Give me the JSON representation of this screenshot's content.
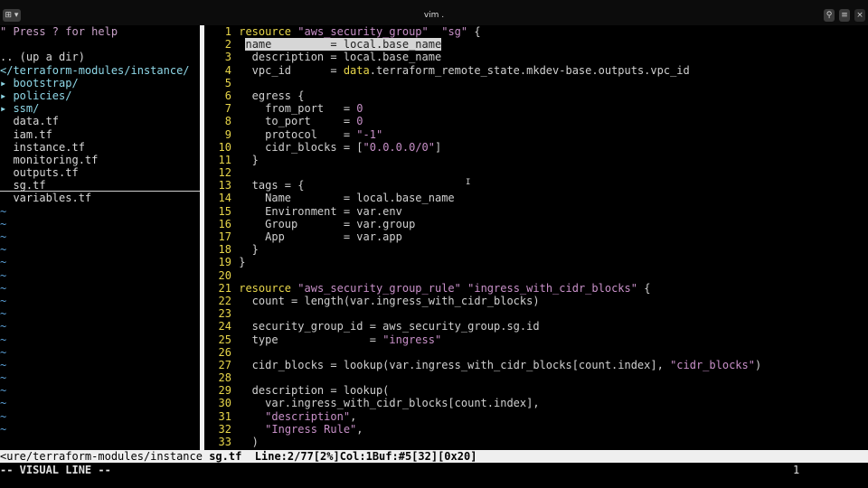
{
  "window": {
    "title": "vim .",
    "left_icon": "⊞ ▾",
    "search_icon": "🔍",
    "menu_icon": "≡",
    "close_icon": "×"
  },
  "tree": {
    "help": "\" Press ? for help",
    "up": ".. (up a dir)",
    "path": "</terraform-modules/instance/",
    "dirs": [
      "▸ bootstrap/",
      "▸ policies/",
      "▸ ssm/"
    ],
    "files": [
      "data.tf",
      "iam.tf",
      "instance.tf",
      "monitoring.tf",
      "outputs.tf",
      "sg.tf",
      "variables.tf"
    ],
    "tilde": "~"
  },
  "code": [
    {
      "n": "1",
      "p": [
        [
          "kw",
          "resource "
        ],
        [
          "str",
          "\"aws_security_group\""
        ],
        [
          "",
          "  "
        ],
        [
          "str",
          "\"sg\""
        ],
        [
          "",
          " {"
        ]
      ]
    },
    {
      "n": "2",
      "p": [
        [
          "",
          " "
        ],
        [
          "sel",
          "name         = local.base_name"
        ]
      ]
    },
    {
      "n": "3",
      "p": [
        [
          "",
          "  description = local.base_name"
        ]
      ]
    },
    {
      "n": "4",
      "p": [
        [
          "",
          "  vpc_id      = "
        ],
        [
          "dk",
          "data"
        ],
        [
          "",
          ".terraform_remote_state.mkdev-base.outputs.vpc_id"
        ]
      ]
    },
    {
      "n": "5",
      "p": [
        [
          "",
          ""
        ]
      ]
    },
    {
      "n": "6",
      "p": [
        [
          "",
          "  egress {"
        ]
      ]
    },
    {
      "n": "7",
      "p": [
        [
          "",
          "    from_port   = "
        ],
        [
          "num",
          "0"
        ]
      ]
    },
    {
      "n": "8",
      "p": [
        [
          "",
          "    to_port     = "
        ],
        [
          "num",
          "0"
        ]
      ]
    },
    {
      "n": "9",
      "p": [
        [
          "",
          "    protocol    = "
        ],
        [
          "str",
          "\"-1\""
        ]
      ]
    },
    {
      "n": "10",
      "p": [
        [
          "",
          "    cidr_blocks = ["
        ],
        [
          "str",
          "\"0.0.0.0/0\""
        ],
        [
          "",
          "]"
        ]
      ]
    },
    {
      "n": "11",
      "p": [
        [
          "",
          "  }"
        ]
      ]
    },
    {
      "n": "12",
      "p": [
        [
          "",
          ""
        ]
      ]
    },
    {
      "n": "13",
      "p": [
        [
          "",
          "  tags = {"
        ]
      ]
    },
    {
      "n": "14",
      "p": [
        [
          "",
          "    Name        = local.base_name"
        ]
      ]
    },
    {
      "n": "15",
      "p": [
        [
          "",
          "    Environment = var.env"
        ]
      ]
    },
    {
      "n": "16",
      "p": [
        [
          "",
          "    Group       = var.group"
        ]
      ]
    },
    {
      "n": "17",
      "p": [
        [
          "",
          "    App         = var.app"
        ]
      ]
    },
    {
      "n": "18",
      "p": [
        [
          "",
          "  }"
        ]
      ]
    },
    {
      "n": "19",
      "p": [
        [
          "",
          "}"
        ]
      ]
    },
    {
      "n": "20",
      "p": [
        [
          "",
          ""
        ]
      ]
    },
    {
      "n": "21",
      "p": [
        [
          "kw",
          "resource "
        ],
        [
          "str",
          "\"aws_security_group_rule\""
        ],
        [
          "",
          " "
        ],
        [
          "str",
          "\"ingress_with_cidr_blocks\""
        ],
        [
          "",
          " {"
        ]
      ]
    },
    {
      "n": "22",
      "p": [
        [
          "",
          "  count = length(var.ingress_with_cidr_blocks)"
        ]
      ]
    },
    {
      "n": "23",
      "p": [
        [
          "",
          ""
        ]
      ]
    },
    {
      "n": "24",
      "p": [
        [
          "",
          "  security_group_id = aws_security_group.sg.id"
        ]
      ]
    },
    {
      "n": "25",
      "p": [
        [
          "",
          "  type              = "
        ],
        [
          "str",
          "\"ingress\""
        ]
      ]
    },
    {
      "n": "26",
      "p": [
        [
          "",
          ""
        ]
      ]
    },
    {
      "n": "27",
      "p": [
        [
          "",
          "  cidr_blocks = lookup(var.ingress_with_cidr_blocks[count.index], "
        ],
        [
          "str",
          "\"cidr_blocks\""
        ],
        [
          "",
          ")"
        ]
      ]
    },
    {
      "n": "28",
      "p": [
        [
          "",
          ""
        ]
      ]
    },
    {
      "n": "29",
      "p": [
        [
          "",
          "  description = lookup("
        ]
      ]
    },
    {
      "n": "30",
      "p": [
        [
          "",
          "    var.ingress_with_cidr_blocks[count.index],"
        ]
      ]
    },
    {
      "n": "31",
      "p": [
        [
          "",
          "    "
        ],
        [
          "str",
          "\"description\""
        ],
        [
          "",
          ","
        ]
      ]
    },
    {
      "n": "32",
      "p": [
        [
          "",
          "    "
        ],
        [
          "str",
          "\"Ingress Rule\""
        ],
        [
          "",
          ","
        ]
      ]
    },
    {
      "n": "33",
      "p": [
        [
          "",
          "  )"
        ]
      ]
    }
  ],
  "status": {
    "path": "<ure/terraform-modules/instance",
    "file": "sg.tf",
    "info": "Line:2/77[2%]Col:1Buf:#5[32][0x20]"
  },
  "cmdline": {
    "mode": "-- VISUAL LINE --",
    "count": "1"
  }
}
